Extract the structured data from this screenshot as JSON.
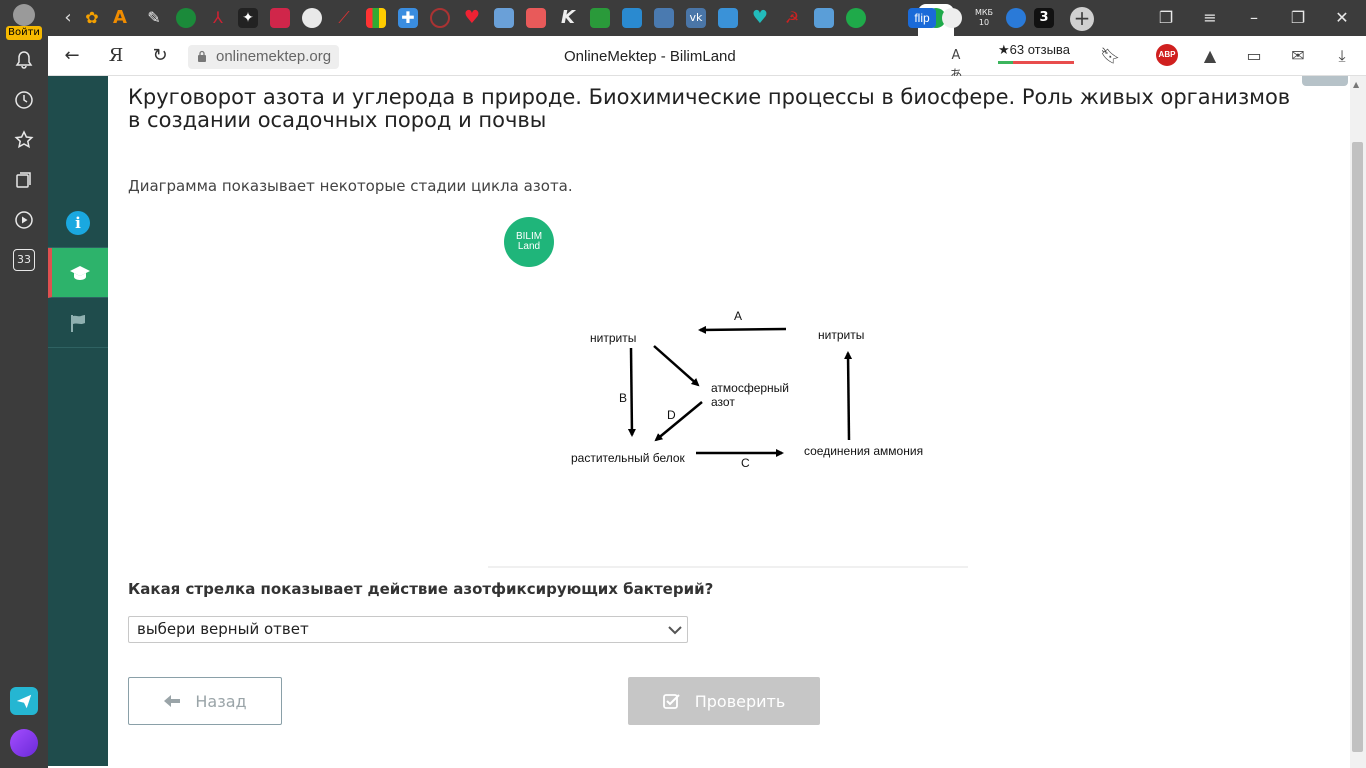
{
  "browser": {
    "login_label": "Войти",
    "sidebar_badge": "33",
    "url": "onlinemektep.org",
    "page_title": "OnlineMektep - BilimLand",
    "rating": "★63 отзыва",
    "adblock": "ABP",
    "tab_labels": [
      "flip",
      "МКБ 10",
      "3"
    ]
  },
  "lesson": {
    "title": "Круговорот азота и углерода в природе. Биохимические процессы в биосфере. Роль живых организмов в создании осадочных пород и почвы",
    "intro": "Диаграмма показывает некоторые стадии цикла азота.",
    "logo_line1": "BILIM",
    "logo_line2": "Land"
  },
  "diagram": {
    "nodes": {
      "nitrites_left": "нитриты",
      "nitrites_right": "нитриты",
      "atm_nitrogen_1": "атмосферный",
      "atm_nitrogen_2": "азот",
      "plant_protein": "растительный белок",
      "ammonium": "соединения аммония"
    },
    "arrows": {
      "a": "A",
      "b": "B",
      "c": "C",
      "d": "D"
    }
  },
  "question": {
    "text": "Какая стрелка показывает действие азотфиксирующих бактерий?",
    "select_placeholder": "выбери верный ответ"
  },
  "buttons": {
    "back": "Назад",
    "check": "Проверить"
  },
  "colors": {
    "course_nav": "#1f4c4c",
    "active_green": "#2db36b",
    "logo_green": "#1fb57a",
    "info_blue": "#1aa8e0",
    "button_disabled": "#c6c6c6"
  }
}
